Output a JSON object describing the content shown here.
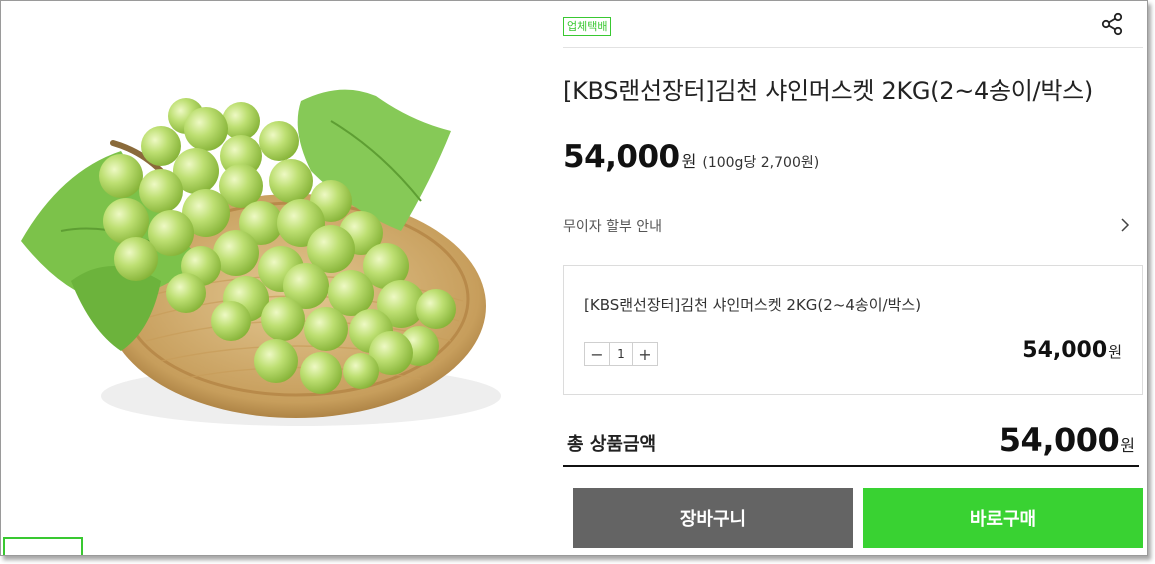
{
  "product": {
    "badge": "업체택배",
    "title": "[KBS랜선장터]김천 샤인머스켓 2KG(2~4송이/박스)",
    "price": "54,000",
    "currency_unit": "원",
    "unit_price_note": "(100g당 2,700원)"
  },
  "installment": {
    "label": "무이자 할부 안내",
    "icon": "chevron-right-icon"
  },
  "option": {
    "name": "[KBS랜선장터]김천 샤인머스켓 2KG(2~4송이/박스)",
    "quantity": "1",
    "minus_label": "−",
    "plus_label": "+",
    "price": "54,000",
    "currency_unit": "원"
  },
  "total": {
    "label": "총 상품금액",
    "price": "54,000",
    "currency_unit": "원"
  },
  "actions": {
    "cart_label": "장바구니",
    "buy_label": "바로구매"
  },
  "icons": {
    "share": "share-icon"
  },
  "colors": {
    "accent_green": "#39d232",
    "badge_green": "#39c831",
    "cart_gray": "#646464"
  }
}
